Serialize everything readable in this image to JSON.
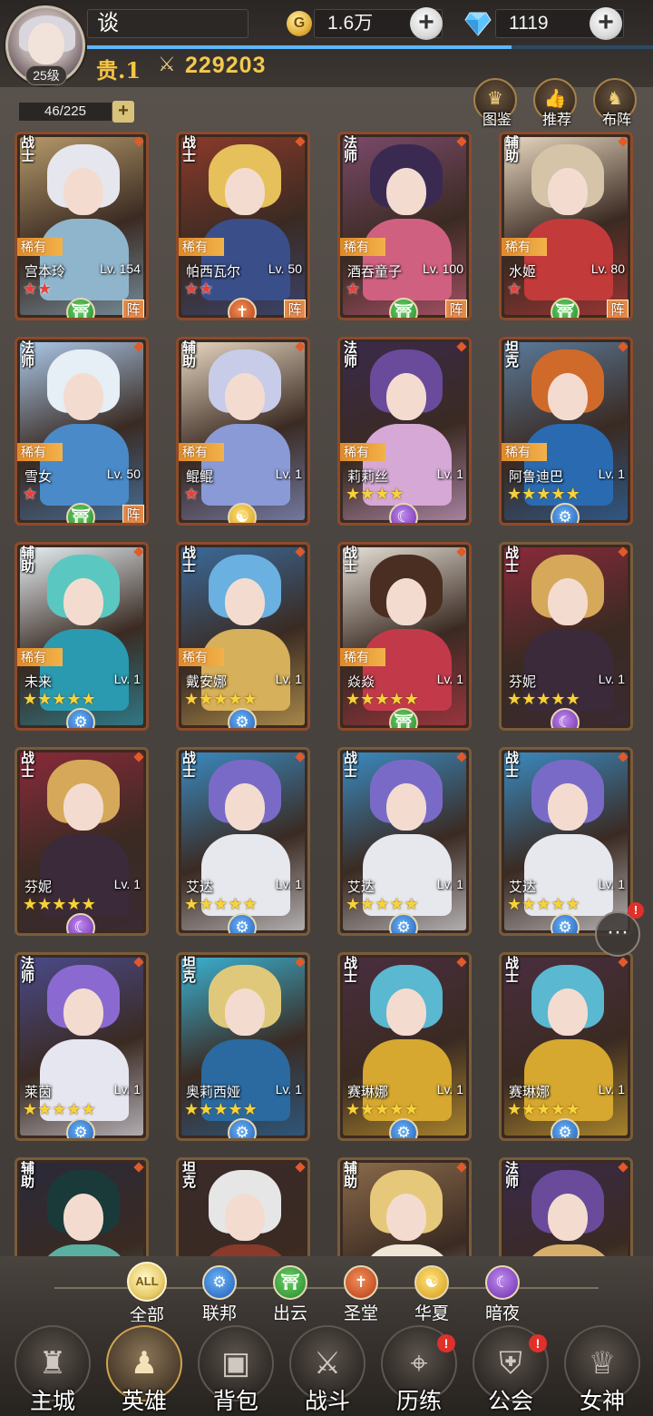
{
  "player": {
    "name": "谈",
    "level": "25级",
    "vip": "贵.1",
    "power": "229203",
    "exp_fraction": 0.75
  },
  "resources": {
    "gold": "1.6万",
    "gems": "1119"
  },
  "hero_count": "46/225",
  "top_buttons": [
    {
      "label": "图鉴",
      "icon": "crown-icon"
    },
    {
      "label": "推荐",
      "icon": "thumbs-up-icon"
    },
    {
      "label": "布阵",
      "icon": "horse-icon"
    }
  ],
  "rare_label": "稀有",
  "formation_label": "阵",
  "heroes": [
    {
      "class": "战士",
      "name": "宫本玲",
      "lv": "Lv. 154",
      "rare": true,
      "stars": 2,
      "star_color": "red",
      "faction": "green",
      "faction_glyph": "⛩",
      "in_formation": true,
      "colors": [
        "#e6e6ee",
        "#8fb5cc",
        "#b59a6a"
      ]
    },
    {
      "class": "战士",
      "name": "帕西瓦尔",
      "lv": "Lv. 50",
      "rare": true,
      "stars": 2,
      "star_color": "red",
      "faction": "orange",
      "faction_glyph": "✝",
      "in_formation": true,
      "colors": [
        "#e6c05a",
        "#3a4e8a",
        "#8a3a2a"
      ]
    },
    {
      "class": "法师",
      "name": "酒吞童子",
      "lv": "Lv. 100",
      "rare": true,
      "stars": 1,
      "star_color": "red",
      "faction": "green",
      "faction_glyph": "⛩",
      "in_formation": true,
      "colors": [
        "#3a2a52",
        "#d06080",
        "#7a4a6a"
      ]
    },
    {
      "class": "辅助",
      "name": "水姬",
      "lv": "Lv. 80",
      "rare": true,
      "stars": 1,
      "star_color": "red",
      "faction": "green",
      "faction_glyph": "⛩",
      "in_formation": true,
      "colors": [
        "#d6c4a8",
        "#c23a3a",
        "#e8d8c0"
      ]
    },
    {
      "class": "法师",
      "name": "雪女",
      "lv": "Lv. 50",
      "rare": true,
      "stars": 1,
      "star_color": "red",
      "faction": "green",
      "faction_glyph": "⛩",
      "in_formation": true,
      "colors": [
        "#e6eef6",
        "#4a8ac8",
        "#aac8e8"
      ]
    },
    {
      "class": "辅助",
      "name": "鲲鲲",
      "lv": "Lv. 1",
      "rare": true,
      "stars": 1,
      "star_color": "red",
      "faction": "gold",
      "faction_glyph": "☯",
      "in_formation": false,
      "colors": [
        "#c8cce8",
        "#8a9ad6",
        "#e6d6c0"
      ]
    },
    {
      "class": "法师",
      "name": "莉莉丝",
      "lv": "Lv. 1",
      "rare": true,
      "stars": 4,
      "star_color": "gold",
      "faction": "purple",
      "faction_glyph": "☾",
      "in_formation": false,
      "colors": [
        "#6a4a9a",
        "#d6a8d6",
        "#3a2a4a"
      ]
    },
    {
      "class": "坦克",
      "name": "阿鲁迪巴",
      "lv": "Lv. 1",
      "rare": true,
      "stars": 5,
      "star_color": "gold",
      "faction": "blue",
      "faction_glyph": "⚙",
      "in_formation": false,
      "colors": [
        "#d06a2a",
        "#2a6ab0",
        "#5a7a9a"
      ]
    },
    {
      "class": "辅助",
      "name": "未来",
      "lv": "Lv. 1",
      "rare": true,
      "stars": 5,
      "star_color": "gold",
      "faction": "blue",
      "faction_glyph": "⚙",
      "in_formation": false,
      "colors": [
        "#5ac8c0",
        "#2a9ab0",
        "#e6f0f4"
      ]
    },
    {
      "class": "战士",
      "name": "戴安娜",
      "lv": "Lv. 1",
      "rare": true,
      "stars": 5,
      "star_color": "gold",
      "faction": "blue",
      "faction_glyph": "⚙",
      "in_formation": false,
      "colors": [
        "#6ab0e0",
        "#d6b05a",
        "#3a6a9a"
      ]
    },
    {
      "class": "战士",
      "name": "焱焱",
      "lv": "Lv. 1",
      "rare": true,
      "stars": 5,
      "star_color": "gold",
      "faction": "green",
      "faction_glyph": "⛩",
      "in_formation": false,
      "colors": [
        "#4a2e22",
        "#c23a4a",
        "#e6e0d6"
      ]
    },
    {
      "class": "战士",
      "name": "芬妮",
      "lv": "Lv. 1",
      "rare": false,
      "stars": 5,
      "star_color": "gold",
      "faction": "purple",
      "faction_glyph": "☾",
      "in_formation": false,
      "colors": [
        "#d6a85a",
        "#3a2a3a",
        "#8a2a3a"
      ]
    },
    {
      "class": "战士",
      "name": "芬妮",
      "lv": "Lv. 1",
      "rare": false,
      "stars": 5,
      "star_color": "gold",
      "faction": "purple",
      "faction_glyph": "☾",
      "in_formation": false,
      "colors": [
        "#d6a85a",
        "#3a2a3a",
        "#8a2a3a"
      ]
    },
    {
      "class": "战士",
      "name": "艾达",
      "lv": "Lv. 1",
      "rare": false,
      "stars": 5,
      "star_color": "gold",
      "faction": "blue",
      "faction_glyph": "⚙",
      "in_formation": false,
      "colors": [
        "#7a6ac8",
        "#e6e8ee",
        "#3a8ac0"
      ]
    },
    {
      "class": "战士",
      "name": "艾达",
      "lv": "Lv. 1",
      "rare": false,
      "stars": 5,
      "star_color": "gold",
      "faction": "blue",
      "faction_glyph": "⚙",
      "in_formation": false,
      "colors": [
        "#7a6ac8",
        "#e6e8ee",
        "#3a8ac0"
      ]
    },
    {
      "class": "战士",
      "name": "艾达",
      "lv": "Lv. 1",
      "rare": false,
      "stars": 5,
      "star_color": "gold",
      "faction": "blue",
      "faction_glyph": "⚙",
      "in_formation": false,
      "colors": [
        "#7a6ac8",
        "#e6e8ee",
        "#3a8ac0"
      ]
    },
    {
      "class": "法师",
      "name": "莱茵",
      "lv": "Lv. 1",
      "rare": false,
      "stars": 5,
      "star_color": "gold",
      "faction": "blue",
      "faction_glyph": "⚙",
      "in_formation": false,
      "colors": [
        "#8a6ad0",
        "#e6e6f0",
        "#4a4a8a"
      ]
    },
    {
      "class": "坦克",
      "name": "奥莉西娅",
      "lv": "Lv. 1",
      "rare": false,
      "stars": 5,
      "star_color": "gold",
      "faction": "blue",
      "faction_glyph": "⚙",
      "in_formation": false,
      "colors": [
        "#e0c87a",
        "#2a6aa0",
        "#3ab0d0"
      ]
    },
    {
      "class": "战士",
      "name": "赛琳娜",
      "lv": "Lv. 1",
      "rare": false,
      "stars": 5,
      "star_color": "gold",
      "faction": "blue",
      "faction_glyph": "⚙",
      "in_formation": false,
      "colors": [
        "#5ab8d0",
        "#d6a830",
        "#4a2e40"
      ]
    },
    {
      "class": "战士",
      "name": "赛琳娜",
      "lv": "Lv. 1",
      "rare": false,
      "stars": 5,
      "star_color": "gold",
      "faction": "blue",
      "faction_glyph": "⚙",
      "in_formation": false,
      "colors": [
        "#5ab8d0",
        "#d6a830",
        "#4a2e40"
      ]
    },
    {
      "class": "辅助",
      "name": "",
      "lv": "",
      "rare": false,
      "stars": 0,
      "star_color": "gold",
      "faction": "",
      "faction_glyph": "",
      "in_formation": false,
      "colors": [
        "#1a3a3a",
        "#5ab0a0",
        "#2a2a3a"
      ]
    },
    {
      "class": "坦克",
      "name": "",
      "lv": "",
      "rare": false,
      "stars": 0,
      "star_color": "gold",
      "faction": "",
      "faction_glyph": "",
      "in_formation": false,
      "colors": [
        "#e6e6e6",
        "#8a3a2a",
        "#3a2a2a"
      ]
    },
    {
      "class": "辅助",
      "name": "",
      "lv": "",
      "rare": false,
      "stars": 0,
      "star_color": "gold",
      "faction": "",
      "faction_glyph": "",
      "in_formation": false,
      "colors": [
        "#e6c87a",
        "#f0e6d6",
        "#8a6a4a"
      ]
    },
    {
      "class": "法师",
      "name": "",
      "lv": "",
      "rare": false,
      "stars": 0,
      "star_color": "gold",
      "faction": "",
      "faction_glyph": "",
      "in_formation": false,
      "colors": [
        "#6a4a9a",
        "#d6b06a",
        "#3a2a4a"
      ]
    }
  ],
  "filters": [
    {
      "label": "全部",
      "icon_text": "ALL",
      "faction": "all"
    },
    {
      "label": "联邦",
      "icon_text": "⚙",
      "faction": "blue"
    },
    {
      "label": "出云",
      "icon_text": "⛩",
      "faction": "green"
    },
    {
      "label": "圣堂",
      "icon_text": "✝",
      "faction": "orange"
    },
    {
      "label": "华夏",
      "icon_text": "☯",
      "faction": "gold"
    },
    {
      "label": "暗夜",
      "icon_text": "☾",
      "faction": "purple"
    }
  ],
  "nav": [
    {
      "label": "主城",
      "icon": "castle-icon",
      "glyph": "♜",
      "alert": false,
      "active": false
    },
    {
      "label": "英雄",
      "icon": "hero-icon",
      "glyph": "♟",
      "alert": false,
      "active": true
    },
    {
      "label": "背包",
      "icon": "backpack-icon",
      "glyph": "▣",
      "alert": false,
      "active": false
    },
    {
      "label": "战斗",
      "icon": "swords-icon",
      "glyph": "⚔",
      "alert": false,
      "active": false
    },
    {
      "label": "历练",
      "icon": "map-icon",
      "glyph": "⌖",
      "alert": true,
      "active": false
    },
    {
      "label": "公会",
      "icon": "shield-icon",
      "glyph": "⛨",
      "alert": true,
      "active": false
    },
    {
      "label": "女神",
      "icon": "goddess-icon",
      "glyph": "♕",
      "alert": false,
      "active": false
    }
  ],
  "alert_mark": "!",
  "chat_icon": "chat-icon"
}
